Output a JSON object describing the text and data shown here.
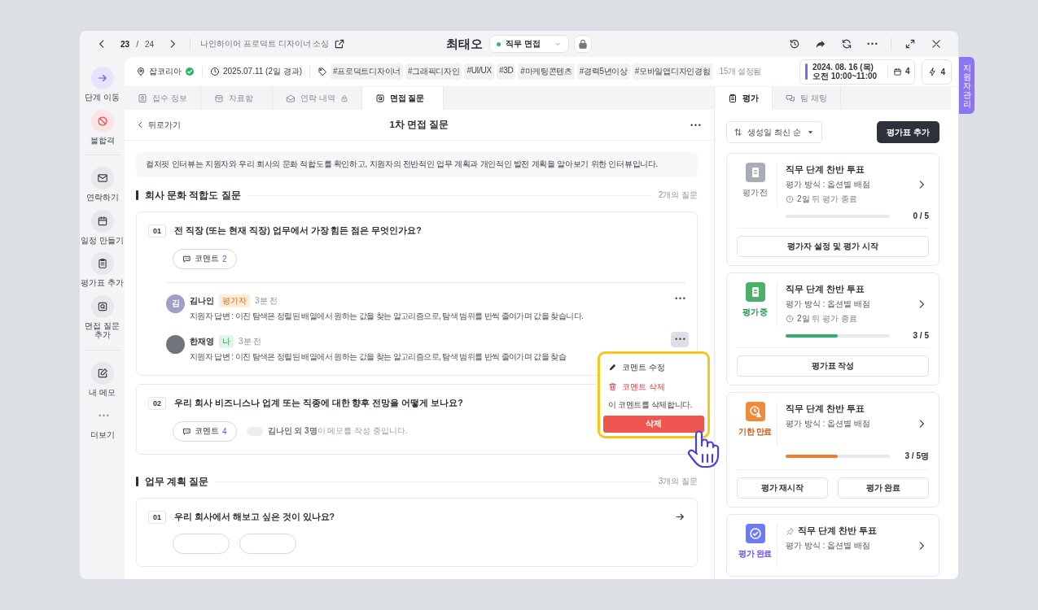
{
  "nav": {
    "current": "23",
    "separator": "/",
    "total": "24",
    "job_posting": "나인하이어 프로덕트 디자이너 소싱"
  },
  "candidate": {
    "name": "최태오",
    "stage": "직무 면접"
  },
  "side_tab": "지원자 관리",
  "sidebar": {
    "groups": [
      [
        {
          "label": "단계 이동",
          "kind": "move"
        },
        {
          "label": "불합격",
          "kind": "reject"
        }
      ],
      [
        {
          "label": "연락하기",
          "kind": "mail"
        },
        {
          "label": "일정 만들기",
          "kind": "calendar"
        },
        {
          "label": "평가표 추가",
          "kind": "clipboard"
        },
        {
          "label": "면접 질문 추가",
          "kind": "question"
        }
      ],
      [
        {
          "label": "내 메모",
          "kind": "memo"
        },
        {
          "label": "더보기",
          "kind": "more"
        }
      ]
    ]
  },
  "info_bar": {
    "source": "잡코리아",
    "source_verified": true,
    "date": "2025.07.11 (2일 경과)",
    "tags": [
      "#프로덕트디자이너",
      "#그래픽디자인",
      "#UI/UX",
      "#3D",
      "#마케팅콘텐츠",
      "#경력5년이상",
      "#모바일앱디자인경험"
    ],
    "tags_more": "15개 설정됨",
    "schedule": "2024. 08. 16 (목) 오전 10:00~11:00",
    "calendar_count": "4",
    "bolt_count": "4"
  },
  "tabs": [
    {
      "label": "접수 정보",
      "kind": "person",
      "selected": false,
      "locked": false
    },
    {
      "label": "자료함",
      "kind": "box",
      "selected": false,
      "locked": false
    },
    {
      "label": "연락 내역",
      "kind": "mail",
      "selected": false,
      "locked": true
    },
    {
      "label": "면접 질문",
      "kind": "question",
      "selected": true,
      "locked": false
    }
  ],
  "question_page": {
    "back": "뒤로가기",
    "title": "1차 면접 질문",
    "intro": "컬처핏 인터뷰는 지원자와 우리 회사의 문화 적합도를 확인하고, 지원자의 전반적인 업무 계획과 개인적인 발전 계획을 알아보기 위한 인터뷰입니다.",
    "sections": [
      {
        "title": "회사 문화 적합도 질문",
        "count": "2개의 질문",
        "questions": [
          {
            "number": "01",
            "text": "전 직장 (또는 현재 직장) 업무에서 가장 힘든 점은 무엇인가요?",
            "kind": "comments",
            "comment_label": "코멘트",
            "comment_count": "2",
            "comments": [
              {
                "author": "김나인",
                "has_photo": false,
                "initial": "김",
                "badge": "평가자",
                "kind": "evaluator",
                "time": "3분 전",
                "text": "지원자 답변 : 이진 탐색은 정렬된 배열에서 원하는 값을 찾는 알고리즘으로, 탐색 범위를 반씩 줄여가며 값을 찾습니다.",
                "menu_open": false
              },
              {
                "author": "한재영",
                "has_photo": true,
                "badge": "나",
                "kind": "me",
                "time": "3분 전",
                "text": "지원자 답변 : 이진 탐색은 정렬된 배열에서 원하는 값을 찾는 알고리즘으로, 탐색 범위를 반씩 줄여가며 값을 찾습",
                "menu_open": true
              }
            ]
          },
          {
            "number": "02",
            "text": "우리 회사 비즈니스나 업계 또는 직종에 대한 향후 전망을 어떻게 보나요?",
            "kind": "comments",
            "comment_label": "코멘트",
            "comment_count": "4",
            "typing_names": "김나인 외 3명",
            "typing_suffix": "이 메모를 작성 중입니다."
          }
        ]
      },
      {
        "title": "업무 계획 질문",
        "count": "3개의 질문",
        "questions": [
          {
            "number": "01",
            "text": "우리 회사에서 해보고 싶은 것이 있나요?",
            "kind": "link"
          }
        ]
      }
    ]
  },
  "context_menu": {
    "items": [
      {
        "label": "코멘트 수정",
        "kind": "edit"
      },
      {
        "label": "코멘트 삭제",
        "kind": "delete"
      }
    ],
    "confirm_text": "이 코멘트를 삭제합니다.",
    "confirm_button": "삭제"
  },
  "side_tabs": [
    {
      "label": "평가",
      "kind": "clipboard",
      "selected": true
    },
    {
      "label": "팀 채팅",
      "kind": "chat",
      "selected": false
    }
  ],
  "sort": "생성일 최신 순",
  "add_button": "평가표 추가",
  "evaluations": [
    {
      "status": "평가 전",
      "kind": "before",
      "pinned": false,
      "title": "직무 단계 찬반 투표",
      "method": "평가 방식 : 옵션별 배점",
      "deadline_strong": "2일",
      "deadline_rest": "뒤 평가 종료",
      "level": 0,
      "progress": "0 / 5",
      "buttons": [
        "평가자 설정 및 평가 시작"
      ]
    },
    {
      "status": "평가 중",
      "kind": "ongoing",
      "pinned": false,
      "title": "직무 단계 찬반 투표",
      "method": "평가 방식 : 옵션별 배점",
      "deadline_strong": "2일",
      "deadline_rest": "뒤 평가 종료",
      "level": 0.5,
      "progress": "3 / 5",
      "buttons": [
        "평가표 작성"
      ]
    },
    {
      "status": "기한 만료",
      "kind": "expired",
      "pinned": false,
      "title": "직무 단계 찬반 투표",
      "method": "평가 방식 : 옵션별 배점",
      "level": 0.5,
      "progress": "3 / 5명",
      "buttons": [
        "평가 재시작",
        "평가 완료"
      ]
    },
    {
      "status": "평가 완료",
      "kind": "done",
      "pinned": true,
      "title": "직무 단계 찬반 투표",
      "method": "평가 방식 : 옵션별 배점"
    }
  ]
}
